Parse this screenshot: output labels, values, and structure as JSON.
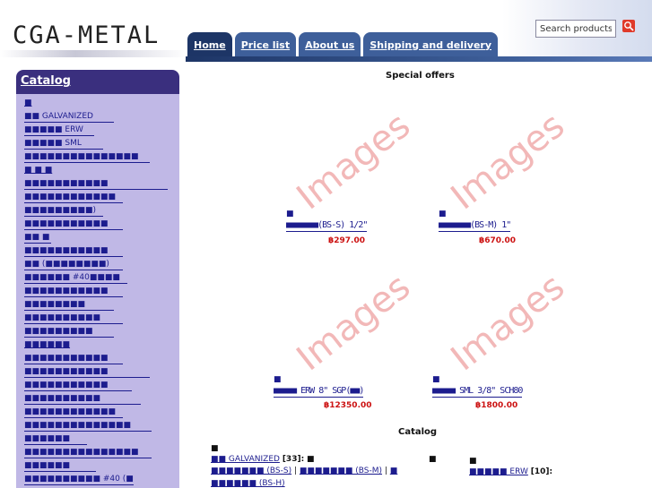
{
  "header": {
    "logo": "CGA-METAL",
    "tabs": [
      "Home",
      "Price list",
      "About us",
      "Shipping and delivery"
    ],
    "search_placeholder": "Search products"
  },
  "sidebar": {
    "title": "Catalog",
    "items": [
      "■",
      "■■ GALVANIZED",
      "■■■■■ ERW",
      "■■■■■ SML",
      "■■■■■■■■■■■■■■■",
      "■ ■ ■",
      "■■■■■■■■■■■",
      "■■■■■■■■■■■■",
      "■■■■■■■■■)",
      "■■■■■■■■■■■",
      "■■ ■",
      "■■■■■■■■■■■",
      "■■ (■■■■■■■■)",
      "■■■■■■ #40■■■■",
      "■■■■■■■■■■■",
      "■■■■■■■■",
      "■■■■■■■■■■",
      "■■■■■■■■■",
      "■■■■■■",
      "■■■■■■■■■■■",
      "■■■■■■■■■■■",
      "■■■■■■■■■■■",
      "■■■■■■■■■■",
      "■■■■■■■■■■■■",
      "■■■■■■■■■■■■■■",
      "■■■■■■",
      "■■■■■■■■■■■■■■■",
      "■■■■■■",
      "■■■■■■■■■■ #40 (■",
      "■■■■■■■■■■■■■■"
    ]
  },
  "main": {
    "special_offers_title": "Special offers",
    "placeholder_text": "Images",
    "products": [
      {
        "icon": "■",
        "name": "■■■■■■■(BS-S) 1/2\"",
        "price": "฿297.00"
      },
      {
        "icon": "■",
        "name": "■■■■■■■(BS-M) 1\"",
        "price": "฿670.00"
      },
      {
        "icon": "■",
        "name": "■■■■■ ERW 8\" SGP(■■)",
        "price": "฿12350.00"
      },
      {
        "icon": "■",
        "name": "■■■■■ SML 3/8\" SCH80",
        "price": "฿1800.00"
      }
    ],
    "catalog_title": "Catalog",
    "catalog_rows": {
      "r1_prefix": "■",
      "r1_link": "■■ GALVANIZED",
      "r1_count": "[33]:",
      "r1_extra": "■",
      "r1_mid": "■",
      "r1_right_prefix": "■",
      "r1_right_link": "■■■■■ ERW",
      "r1_right_count": "[10]:",
      "r2_link1": "■■■■■■■ (BS-S)",
      "r2_link2": "■■■■■■■ (BS-M)",
      "r2_link3": "■",
      "r3_link": "■■■■■■ (BS-H)"
    }
  },
  "colors": {
    "nav_tab": "#3e5f9a",
    "nav_tab_active": "#1d3566",
    "sidebar_bg": "#c0b8e6",
    "sidebar_head": "#3a2f7e",
    "link": "#1c1c8e",
    "price": "#cc1111",
    "placeholder": "#f2b8b8"
  }
}
